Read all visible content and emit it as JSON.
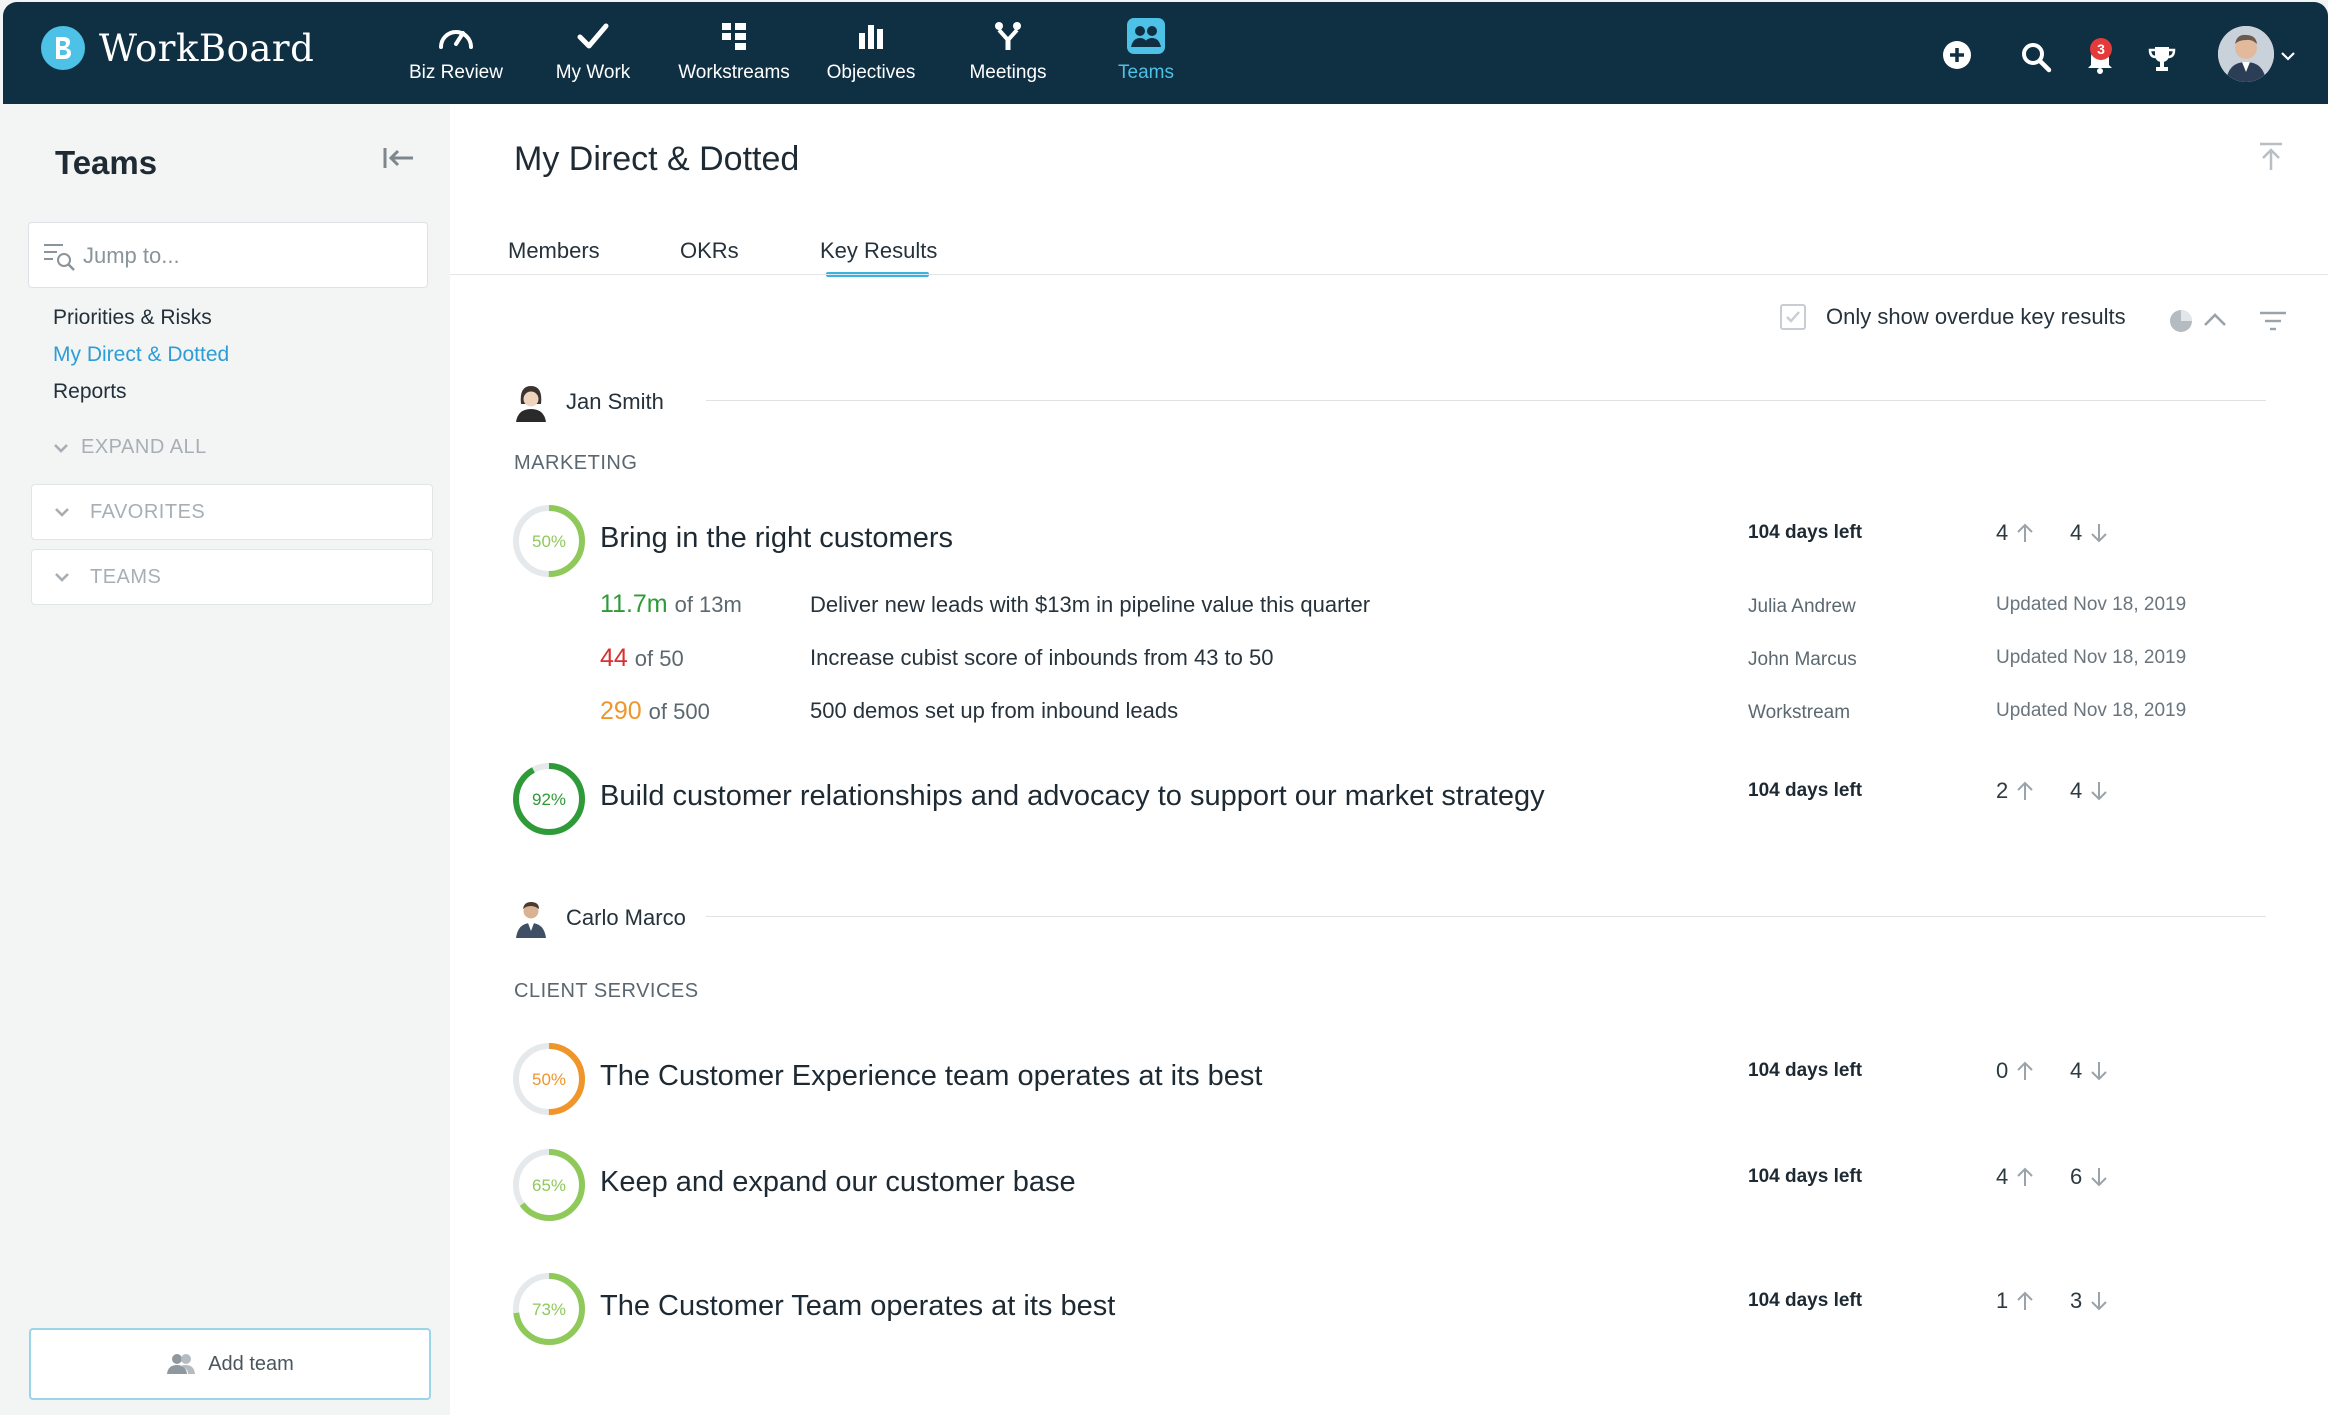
{
  "app": {
    "brand": "WorkBoard",
    "colors": {
      "nav_bg": "#0f2f43",
      "accent": "#4dc1e6",
      "link": "#2e9dd6",
      "green": "#2e9b38",
      "light_green": "#8ec95a",
      "orange": "#f0952a",
      "red": "#d9302f"
    }
  },
  "nav": {
    "items": [
      {
        "label": "Biz Review",
        "icon": "gauge-icon"
      },
      {
        "label": "My Work",
        "icon": "checkmark-icon"
      },
      {
        "label": "Workstreams",
        "icon": "workstreams-icon"
      },
      {
        "label": "Objectives",
        "icon": "bar-chart-icon"
      },
      {
        "label": "Meetings",
        "icon": "meetings-icon"
      },
      {
        "label": "Teams",
        "icon": "teams-icon",
        "active": true
      }
    ],
    "notification_count": "3"
  },
  "sidebar": {
    "title": "Teams",
    "search_placeholder": "Jump to...",
    "links": [
      "Priorities & Risks",
      "My Direct & Dotted",
      "Reports"
    ],
    "active_link": "My Direct & Dotted",
    "expand_all": "EXPAND ALL",
    "groups": [
      "FAVORITES",
      "TEAMS"
    ],
    "add_team": "Add team"
  },
  "main": {
    "title": "My Direct & Dotted",
    "tabs": [
      "Members",
      "OKRs",
      "Key Results"
    ],
    "active_tab": "Key Results",
    "overdue_label": "Only show overdue key results"
  },
  "people": [
    {
      "name": "Jan Smith",
      "section": "MARKETING",
      "objectives": [
        {
          "title": "Bring in the right customers",
          "progress": 50,
          "ring_color": "#8ec95a",
          "days_left": "104 days left",
          "up": "4",
          "down": "4",
          "key_results": [
            {
              "value": "11.7m",
              "of": "of 13m",
              "value_color": "#2e9b38",
              "desc": "Deliver new leads with $13m in pipeline value this quarter",
              "owner": "Julia Andrew",
              "updated": "Updated Nov 18, 2019"
            },
            {
              "value": "44",
              "of": "of 50",
              "value_color": "#d9302f",
              "desc": "Increase cubist score of inbounds from 43 to 50",
              "owner": "John Marcus",
              "updated": "Updated Nov 18, 2019"
            },
            {
              "value": "290",
              "of": "of 500",
              "value_color": "#f0952a",
              "desc": "500 demos set up from inbound leads",
              "owner": "Workstream",
              "updated": "Updated Nov 18, 2019"
            }
          ]
        },
        {
          "title": "Build customer relationships and advocacy to support our market strategy",
          "progress": 92,
          "ring_color": "#2e9b38",
          "days_left": "104 days left",
          "up": "2",
          "down": "4"
        }
      ]
    },
    {
      "name": "Carlo Marco",
      "section": "CLIENT SERVICES",
      "objectives": [
        {
          "title": "The Customer Experience team operates at its best",
          "progress": 50,
          "ring_color": "#f0952a",
          "days_left": "104 days left",
          "up": "0",
          "down": "4"
        },
        {
          "title": "Keep and expand our customer base",
          "progress": 65,
          "ring_color": "#8ec95a",
          "days_left": "104 days left",
          "up": "4",
          "down": "6"
        },
        {
          "title": "The Customer Team operates at its best",
          "progress": 73,
          "ring_color": "#8ec95a",
          "days_left": "104 days left",
          "up": "1",
          "down": "3"
        }
      ]
    }
  ]
}
